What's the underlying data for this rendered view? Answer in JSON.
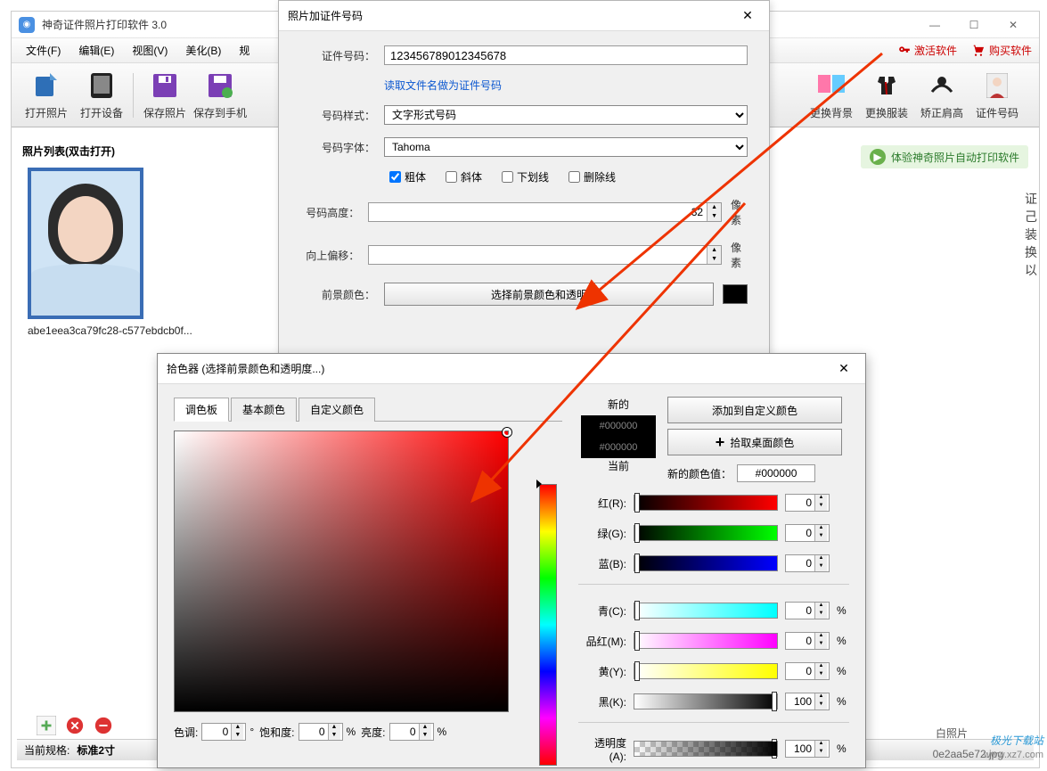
{
  "main": {
    "title": "神奇证件照片打印软件 3.0",
    "menu": {
      "file": "文件(F)",
      "edit": "编辑(E)",
      "view": "视图(V)",
      "beautify": "美化(B)",
      "size": "规"
    },
    "right_links": {
      "activate": "激活软件",
      "buy": "购买软件"
    },
    "toolbar": {
      "open_photo": "打开照片",
      "open_device": "打开设备",
      "save_photo": "保存照片",
      "save_mobile": "保存到手机",
      "change_bg": "更换背景",
      "change_clothes": "更换服装",
      "fix_shoulder": "矫正肩高",
      "id_number": "证件号码",
      "promo": "体验神奇照片自动打印软件"
    },
    "sidebar": {
      "header": "照片列表(双击打开)",
      "thumb_name": "abe1eea3ca79fc28-c577ebdcb0f..."
    },
    "status": {
      "prefix": "当前规格:",
      "spec": "标准2寸",
      "filename_tail": "0e2aa5e72.jpg"
    },
    "footer_caption": "白照片",
    "side_text": "证己装换以"
  },
  "dlg1": {
    "title": "照片加证件号码",
    "id_label": "证件号码：",
    "id_value": "123456789012345678",
    "read_filename": "读取文件名做为证件号码",
    "style_label": "号码样式：",
    "style_value": "文字形式号码",
    "font_label": "号码字体：",
    "font_value": "Tahoma",
    "bold": "粗体",
    "italic": "斜体",
    "underline": "下划线",
    "strike": "删除线",
    "height_label": "号码高度：",
    "height_value": "32",
    "unit_px": "像素",
    "offset_label": "向上偏移：",
    "offset_value": "",
    "fg_label": "前景颜色：",
    "fg_btn": "选择前景颜色和透明度..."
  },
  "dlg2": {
    "title": "拾色器 (选择前景颜色和透明度...)",
    "tabs": {
      "palette": "调色板",
      "basic": "基本颜色",
      "custom": "自定义颜色"
    },
    "new_label": "新的",
    "current_label": "当前",
    "hex_new": "#000000",
    "hex_cur": "#000000",
    "add_custom": "添加到自定义颜色",
    "eyedropper": "拾取桌面颜色",
    "new_hex_label": "新的颜色值：",
    "new_hex_value": "#000000",
    "rgb": {
      "r_label": "红(R):",
      "g_label": "绿(G):",
      "b_label": "蓝(B):",
      "r": "0",
      "g": "0",
      "b": "0"
    },
    "cmyk": {
      "c_label": "青(C):",
      "m_label": "品红(M):",
      "y_label": "黄(Y):",
      "k_label": "黑(K):",
      "c": "0",
      "m": "0",
      "y": "0",
      "k": "100"
    },
    "alpha_label": "透明度(A):",
    "alpha": "100",
    "hsl": {
      "h_label": "色调:",
      "s_label": "饱和度:",
      "l_label": "亮度:",
      "h": "0",
      "s": "0",
      "l": "0"
    },
    "pct": "%"
  },
  "watermark": {
    "line1": "极光下载站",
    "line2": "www.xz7.com"
  }
}
